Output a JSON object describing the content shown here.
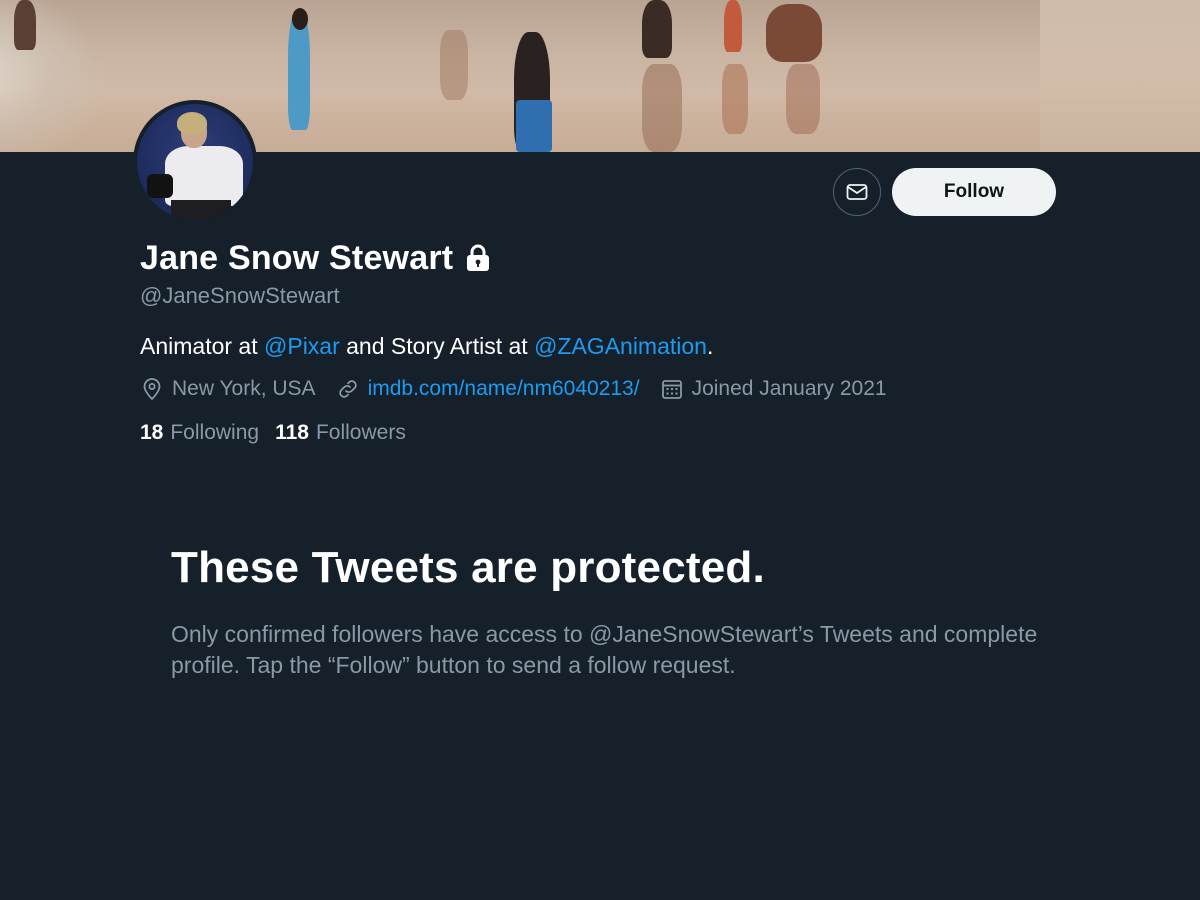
{
  "profile": {
    "name": "Jane Snow Stewart",
    "handle": "@JaneSnowStewart",
    "bio_parts": [
      "Animator at ",
      "@Pixar",
      " and Story Artist at ",
      "@ZAGAnimation",
      "."
    ],
    "location": "New York, USA",
    "website": "imdb.com/name/nm6040213/",
    "joined": "Joined January 2021",
    "following_count": "18",
    "following_label": "Following",
    "followers_count": "118",
    "followers_label": "Followers"
  },
  "actions": {
    "follow_label": "Follow"
  },
  "protected": {
    "title": "These Tweets are protected.",
    "body": "Only confirmed followers have access to @JaneSnowStewart’s Tweets and complete profile. Tap the “Follow” button to send a follow request."
  },
  "icons": {
    "lock": "lock-icon",
    "message": "envelope-icon",
    "location": "location-pin-icon",
    "link": "link-icon",
    "calendar": "calendar-icon"
  },
  "colors": {
    "background": "#15202b",
    "accent": "#1d9bf0",
    "secondary_text": "#8b98a5",
    "follow_button": "#eff3f4"
  }
}
